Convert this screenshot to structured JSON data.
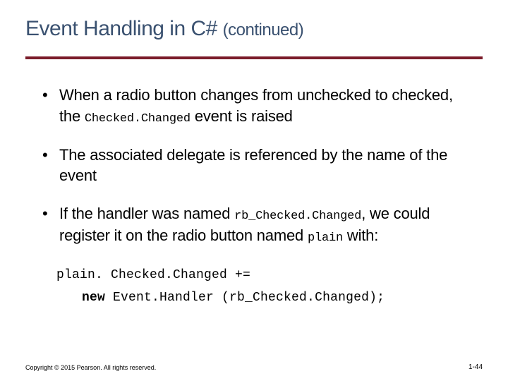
{
  "title_main": "Event Handling in C# ",
  "title_cont": "(continued)",
  "bullets": [
    {
      "pre": "When a radio button changes from unchecked to checked, the ",
      "code": "Checked.Changed",
      "post": " event is raised"
    },
    {
      "pre": "The associated delegate is referenced by the name of the event",
      "code": "",
      "post": ""
    },
    {
      "pre": "If the handler was named ",
      "code": "rb_Checked.Changed",
      "post": ", we could register it on the radio button named ",
      "code2": "plain",
      "post2": " with:"
    }
  ],
  "code_line1": "plain. Checked.Changed +=",
  "code_line2_kw": "new",
  "code_line2_rest": " Event.Handler (rb_Checked.Changed);",
  "copyright": "Copyright © 2015 Pearson. All rights reserved.",
  "page_num": "1-44"
}
